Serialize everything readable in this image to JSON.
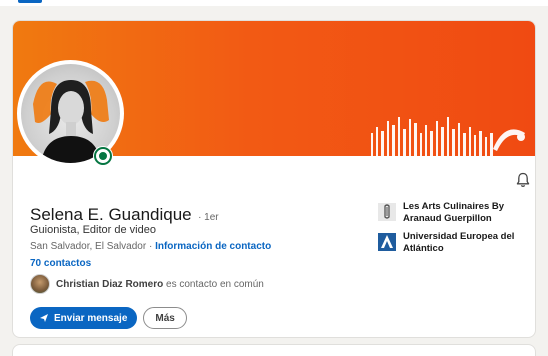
{
  "profile": {
    "name": "Selena E. Guandique",
    "degree": "· 1er",
    "headline": "Guionista, Editor de video",
    "location": "San Salvador, El Salvador",
    "separator": " · ",
    "contact_info_label": "Información de contacto",
    "connections_label": "70 contactos",
    "mutual": {
      "name": "Christian Diaz Romero",
      "suffix": " es contacto en común"
    }
  },
  "actions": {
    "message_label": "Enviar mensaje",
    "more_label": "Más"
  },
  "organizations": [
    {
      "name": "Les Arts Culinaires By Aranaud Guerpillon",
      "icon": "chef-logo-icon"
    },
    {
      "name": "Universidad Europea del Atlántico",
      "icon": "university-logo-icon"
    }
  ],
  "colors": {
    "brand_blue": "#0a66c2",
    "banner_orange": "#f25a14",
    "online_green": "#057642"
  },
  "icons": {
    "bell": "bell-icon",
    "send": "paper-plane-icon"
  }
}
